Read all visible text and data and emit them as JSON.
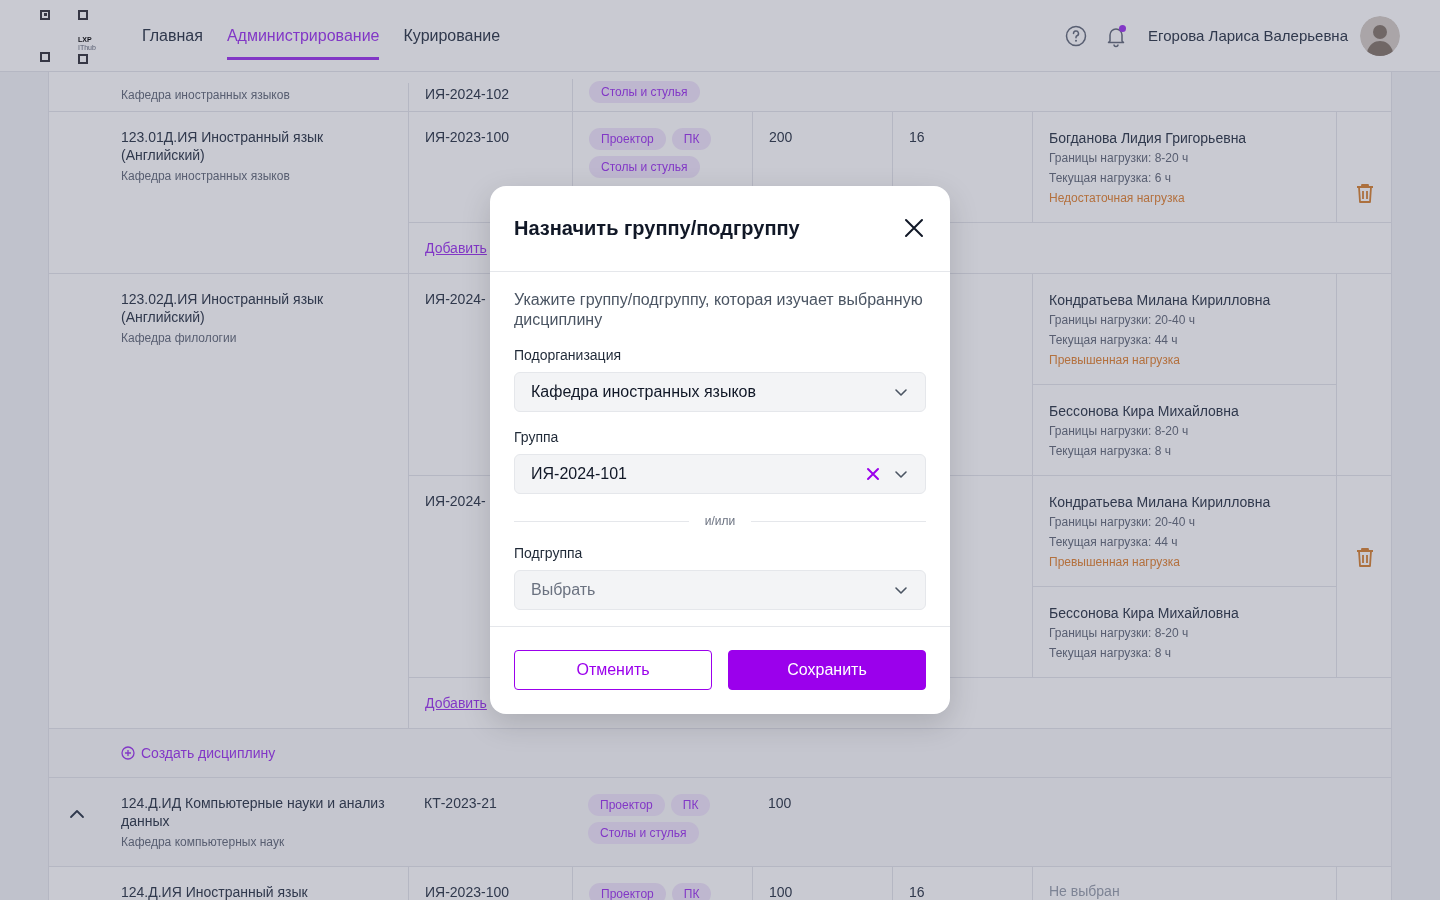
{
  "header": {
    "logo": {
      "line1": "LXP",
      "line2": "IThub"
    },
    "nav": [
      {
        "label": "Главная",
        "selected": false
      },
      {
        "label": "Администрирование",
        "selected": true
      },
      {
        "label": "Курирование",
        "selected": false
      }
    ],
    "notification": true,
    "user_name": "Егорова Лариса Валерьевна"
  },
  "table": {
    "rows": [
      {
        "kind": "partial",
        "department": "Кафедра иностранных языков",
        "group": "ИЯ-2024-102",
        "tags": [
          "Столы и стулья"
        ]
      },
      {
        "kind": "discipline",
        "title": "123.01Д.ИЯ Иностранный язык (Английский)",
        "department": "Кафедра иностранных языков",
        "groups": [
          {
            "code": "ИЯ-2023-100",
            "tags": [
              "Проектор",
              "ПК",
              "Столы и стулья"
            ],
            "hours": "200",
            "weeks": "16",
            "trash": true,
            "teachers": [
              {
                "name": "Богданова Лидия Григорьевна",
                "limits": "Границы нагрузки: 8-20 ч",
                "current": "Текущая нагрузка: 6 ч",
                "warning": "Недостаточная нагрузка"
              }
            ]
          }
        ],
        "add_link": "Добавить"
      },
      {
        "kind": "discipline",
        "title": "123.02Д.ИЯ Иностранный язык (Английский)",
        "department": "Кафедра филологии",
        "groups": [
          {
            "code": "ИЯ-2024-",
            "trash": false,
            "teachers": [
              {
                "name": "Кондратьева Милана Кирилловна",
                "limits": "Границы нагрузки: 20-40 ч",
                "current": "Текущая нагрузка: 44 ч",
                "warning": "Превышенная нагрузка"
              },
              {
                "name": "Бессонова Кира Михайловна",
                "limits": "Границы нагрузки: 8-20 ч",
                "current": "Текущая нагрузка: 8 ч"
              }
            ]
          },
          {
            "code": "ИЯ-2024-",
            "trash": true,
            "teachers": [
              {
                "name": "Кондратьева Милана Кирилловна",
                "limits": "Границы нагрузки: 20-40 ч",
                "current": "Текущая нагрузка: 44 ч",
                "warning": "Превышенная нагрузка"
              },
              {
                "name": "Бессонова Кира Михайловна",
                "limits": "Границы нагрузки: 8-20 ч",
                "current": "Текущая нагрузка: 8 ч"
              }
            ]
          }
        ],
        "add_link": "Добавить"
      },
      {
        "kind": "create",
        "label": "Создать дисциплину"
      },
      {
        "kind": "parent",
        "expanded": true,
        "title": "124.Д.ИД Компьютерные науки и анализ данных",
        "department": "Кафедра компьютерных наук",
        "code": "КТ-2023-21",
        "tags": [
          "Проектор",
          "ПК",
          "Столы и стулья"
        ],
        "hours": "100"
      },
      {
        "kind": "discipline",
        "title": "124.Д.ИЯ Иностранный язык",
        "groups": [
          {
            "code": "ИЯ-2023-100",
            "tags": [
              "Проектор",
              "ПК"
            ],
            "hours": "100",
            "weeks": "16",
            "trash": false,
            "teacher_placeholder": "Не выбран"
          }
        ]
      }
    ]
  },
  "modal": {
    "title": "Назначить группу/подгруппу",
    "description": "Укажите группу/подгруппу, которая изучает выбранную дисциплину",
    "fields": [
      {
        "kind": "select",
        "label": "Подорганизация",
        "value": "Кафедра иностранных языков",
        "clearable": false
      },
      {
        "kind": "select",
        "label": "Группа",
        "value": "ИЯ-2024-101",
        "clearable": true
      },
      {
        "kind": "divider",
        "label": "и/или"
      },
      {
        "kind": "select",
        "label": "Подгруппа",
        "placeholder": "Выбрать",
        "clearable": false
      }
    ],
    "buttons": [
      {
        "label": "Отменить",
        "kind": "secondary"
      },
      {
        "label": "Сохранить",
        "kind": "primary"
      }
    ]
  }
}
